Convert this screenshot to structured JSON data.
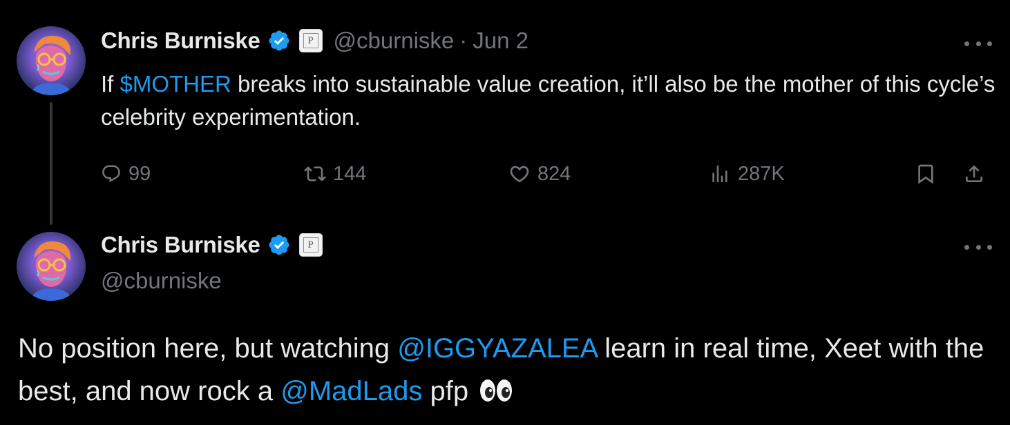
{
  "parent_tweet": {
    "author_name": "Chris Burniske",
    "affiliation_glyph": "P",
    "handle": "@cburniske",
    "separator": "·",
    "date": "Jun 2",
    "text_before": "If ",
    "text_link": "$MOTHER",
    "text_after": " breaks into sustainable value creation, it’ll also be the mother of this cycle’s celebrity experimentation.",
    "replies": "99",
    "reposts": "144",
    "likes": "824",
    "views": "287K"
  },
  "main_tweet": {
    "author_name": "Chris Burniske",
    "affiliation_glyph": "P",
    "handle": "@cburniske",
    "text_1": "No position here, but watching ",
    "mention_1": "@IGGYAZALEA",
    "text_2": " learn in real time, Xeet with the best, and now rock a ",
    "mention_2": "@MadLads",
    "text_3": " pfp"
  },
  "colors": {
    "background": "#000000",
    "text": "#e7e9ea",
    "secondary": "#71767b",
    "link": "#1d9bf0",
    "verified": "#1d9bf0"
  },
  "icons": [
    "avatar",
    "verified-badge-icon",
    "affiliate-badge-icon",
    "more-options-icon",
    "reply-icon",
    "repost-icon",
    "like-icon",
    "views-icon",
    "bookmark-icon",
    "share-icon",
    "eyes-emoji-icon"
  ]
}
